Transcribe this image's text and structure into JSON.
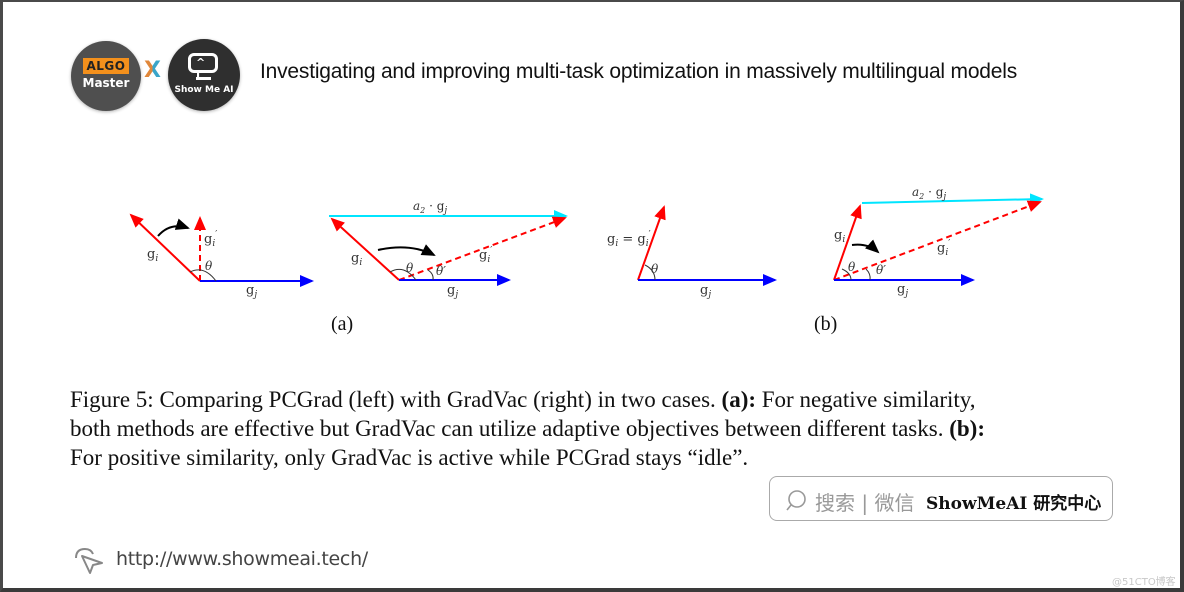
{
  "header": {
    "logo_left": {
      "tag": "ALGO",
      "name": "Master"
    },
    "logo_separator": "X",
    "logo_right": {
      "screen_glyph": "^ I",
      "name": "Show Me AI"
    },
    "title": "Investigating and improving multi-task optimization in massively multilingual models"
  },
  "figure": {
    "colors": {
      "g_i": "#ff0000",
      "g_j": "#0000ff",
      "a2_gj": "#00e5ff",
      "arc": "#000000"
    },
    "panels": [
      {
        "id": "a-left",
        "method": "PCGrad",
        "labels": {
          "gi": "g",
          "gi_sub": "i",
          "gi_prime": "g′",
          "gj": "g",
          "gj_sub": "j",
          "theta": "θ"
        }
      },
      {
        "id": "a-right",
        "method": "GradVac",
        "labels": {
          "a2gj": "a₂ · g",
          "a2gj_sub": "j",
          "gi": "g",
          "gi_prime": "g′",
          "gj": "g",
          "theta": "θ",
          "theta_prime": "θ′"
        }
      },
      {
        "id": "b-left",
        "method": "PCGrad",
        "labels": {
          "gi_eq": "g",
          "eq": " = g′",
          "gj": "g",
          "theta": "θ"
        }
      },
      {
        "id": "b-right",
        "method": "GradVac",
        "labels": {
          "a2gj": "a₂ · g",
          "gi": "g",
          "gi_prime": "g′",
          "gj": "g",
          "theta": "θ",
          "theta_prime": "θ′"
        }
      }
    ],
    "sublabels": [
      "(a)",
      "(b)"
    ]
  },
  "caption": {
    "line1_pre": "Figure 5: Comparing PCGrad (left) with GradVac (right) in two cases. ",
    "line1_bold": "(a):",
    "line1_post": " For negative similarity,",
    "line2_pre": "both methods are effective but GradVac can utilize adaptive objectives between different tasks. ",
    "line2_bold": "(b):",
    "line3": "For positive similarity, only GradVac is active while PCGrad stays “idle”."
  },
  "search_box": {
    "hint": "搜索 | 微信",
    "brand": "ShowMeAI 研究中心"
  },
  "footer": {
    "url": "http://www.showmeai.tech/"
  },
  "watermark": "@51CTO博客"
}
